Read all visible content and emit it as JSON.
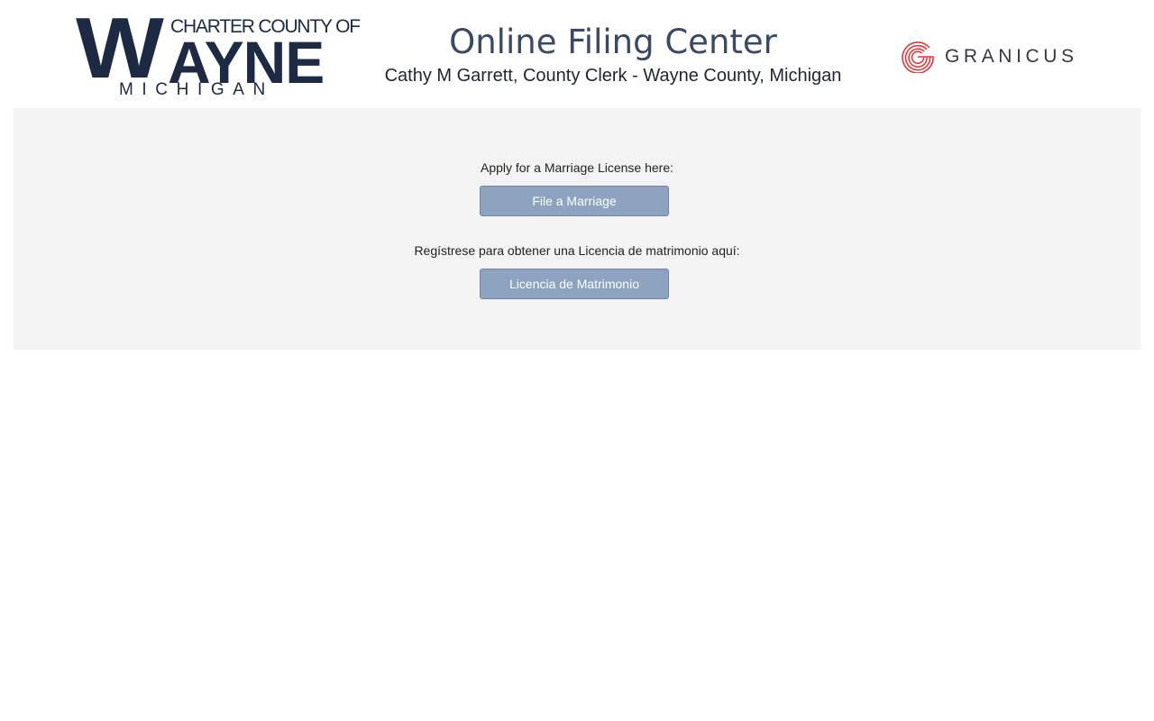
{
  "header": {
    "logo": {
      "charter_text": "CHARTER COUNTY OF",
      "name_text": "WAYNE",
      "state_text": "MICHIGAN"
    },
    "title": "Online Filing Center",
    "subtitle": "Cathy M Garrett, County Clerk - Wayne County, Michigan",
    "partner_logo": {
      "icon": "granicus-g-icon",
      "text": "GRANICUS",
      "color": "#e0393e"
    }
  },
  "main": {
    "english": {
      "prompt": "Apply for a Marriage License here:",
      "button_label": "File a Marriage"
    },
    "spanish": {
      "prompt": "Regístrese para obtener una Licencia de matrimonio aquí:",
      "button_label": "Licencia de Matrimonio"
    }
  },
  "colors": {
    "brand_navy": "#1c2a44",
    "title": "#3a4a66",
    "button_bg": "#8ea3bf",
    "panel_bg": "#f3f3f3"
  }
}
